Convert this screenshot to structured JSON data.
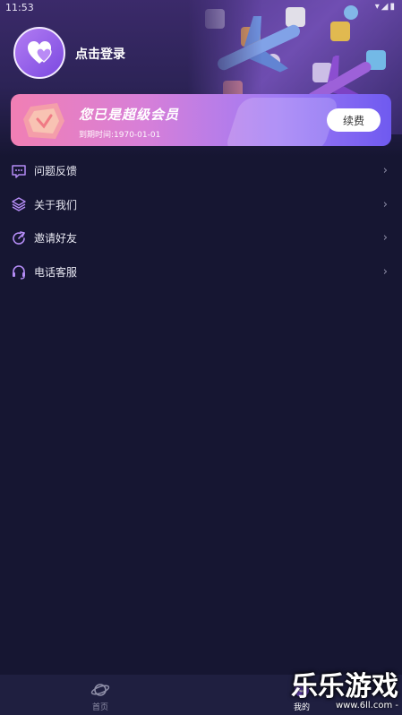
{
  "status_bar": {
    "time": "11:53",
    "icons": "▾◢▮"
  },
  "profile": {
    "login_label": "点击登录"
  },
  "vip": {
    "title": "您已是超级会员",
    "expire": "到期时间:1970-01-01",
    "renew_label": "续费"
  },
  "menu": {
    "items": [
      {
        "label": "问题反馈",
        "icon": "feedback-icon",
        "chevron": "›"
      },
      {
        "label": "关于我们",
        "icon": "layers-icon",
        "chevron": "›"
      },
      {
        "label": "邀请好友",
        "icon": "invite-icon",
        "chevron": "›"
      },
      {
        "label": "电话客服",
        "icon": "headset-icon",
        "chevron": "›"
      }
    ]
  },
  "tabs": [
    {
      "label": "首页",
      "icon": "planet-icon"
    },
    {
      "label": "我的",
      "icon": "profile-icon"
    }
  ],
  "watermark": {
    "main": "乐乐游戏",
    "sub": "www.6ll.com -"
  },
  "colors": {
    "background": "#161632",
    "accent_purple": "#a78bfa",
    "vip_gradient_start": "#f17fb4",
    "vip_gradient_end": "#6f5af0"
  }
}
